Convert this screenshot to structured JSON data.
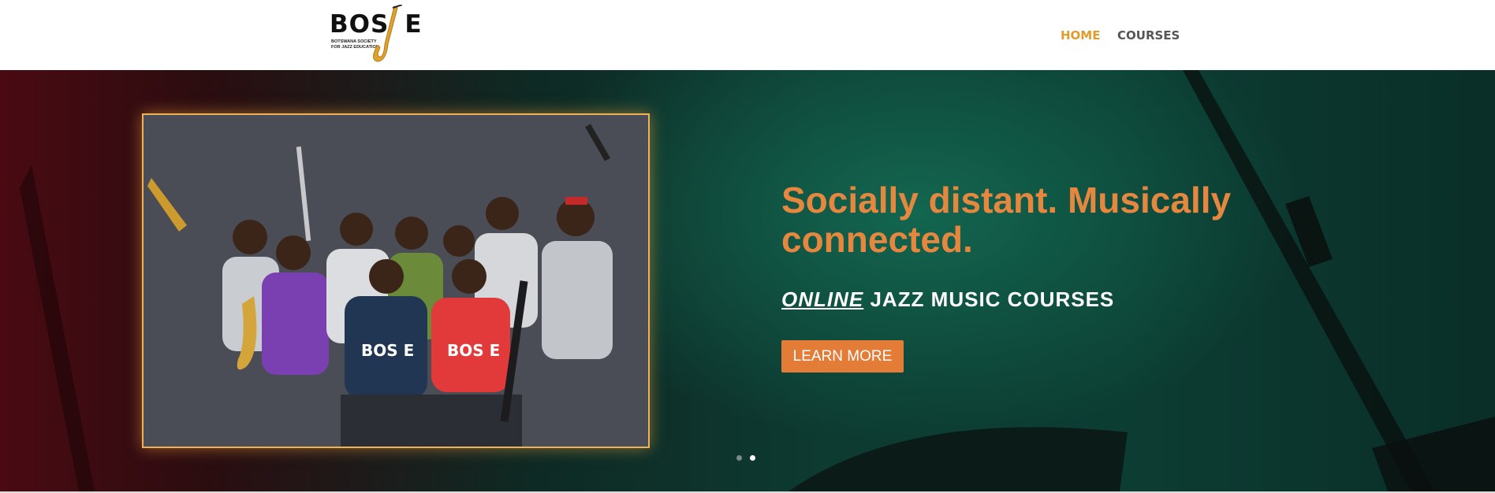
{
  "header": {
    "logo": {
      "text": "BOS  E",
      "subtitle": "BOTSWANA SOCIETY\nFOR JAZZ EDUCATION"
    },
    "nav": [
      {
        "label": "HOME",
        "active": true
      },
      {
        "label": "COURSES",
        "active": false
      }
    ]
  },
  "hero": {
    "headline": "Socially distant. Musically connected.",
    "subheadline_em": "ONLINE",
    "subheadline_rest": " JAZZ MUSIC COURSES",
    "button_label": "LEARN MORE",
    "slides": {
      "count": 2,
      "active_index": 1
    }
  },
  "colors": {
    "accent": "#e09c2d",
    "headline": "#e5873f",
    "button": "#e27c36",
    "frame": "#f0b257"
  }
}
